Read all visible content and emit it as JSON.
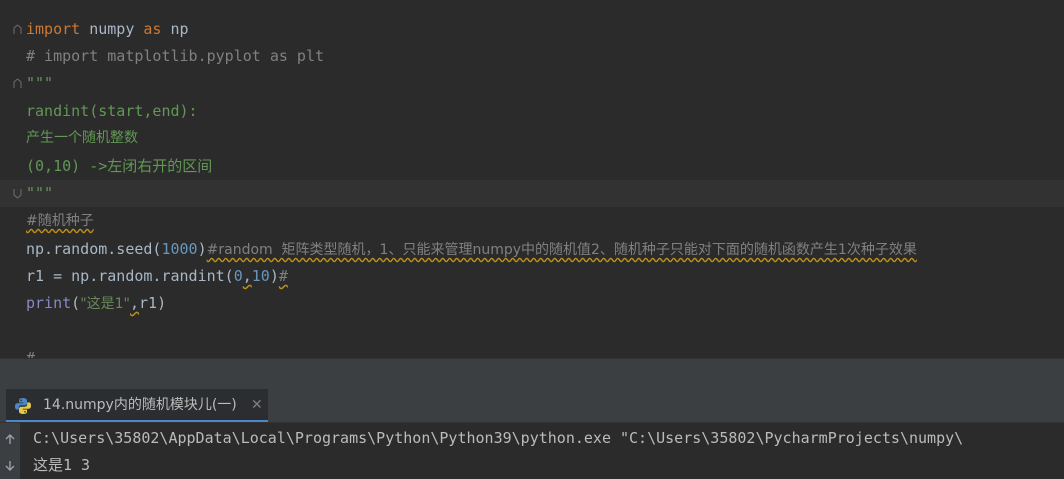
{
  "editor": {
    "lines": [
      {
        "kw1": "import",
        "mid": " numpy ",
        "kw2": "as",
        "end": " np"
      },
      {
        "comment": "# import matplotlib.pyplot as plt"
      },
      {
        "docstring": "\"\"\""
      },
      {
        "docstring": "randint(start,end):"
      },
      {
        "docstring": "产生一个随机整数"
      },
      {
        "docstring": "(0,10) ->左闭右开的区间"
      },
      {
        "docstring": "\"\"\""
      },
      {
        "comment": "#随机种子"
      },
      {
        "pre": "np.random.seed(",
        "num": "1000",
        "post": ")",
        "comment": "#random  矩阵类型随机，1、只能来管理numpy中的随机值2、随机种子只能对下面的随机函数产生1次种子效果"
      },
      {
        "pre": "r1 = np.random.randint(",
        "num1": "0",
        "sep": ",",
        "num2": "10",
        "post": ")",
        "comment": "#"
      },
      {
        "builtin": "print",
        "open": "(",
        "str": "\"这是1\"",
        "sep": ",",
        "arg": "r1",
        "close": ")"
      },
      {
        "code": ""
      },
      {
        "comment": "#"
      }
    ]
  },
  "run": {
    "tab_label": "14.numpy内的随机模块儿(一)",
    "tab_close": "✕",
    "console_lines": [
      "C:\\Users\\35802\\AppData\\Local\\Programs\\Python\\Python39\\python.exe \"C:\\Users\\35802\\PycharmProjects\\numpy\\",
      "这是1 3"
    ]
  },
  "icons": {
    "fold": "fold-marker-icon",
    "python": "python-icon",
    "rerun": "rerun-icon",
    "down": "scroll-down-icon"
  },
  "colors": {
    "keyword": "#cc7832",
    "comment": "#808080",
    "docstring": "#629755",
    "number": "#6897bb",
    "string": "#6a8759",
    "builtin": "#8888c6",
    "text": "#a9b7c6"
  }
}
